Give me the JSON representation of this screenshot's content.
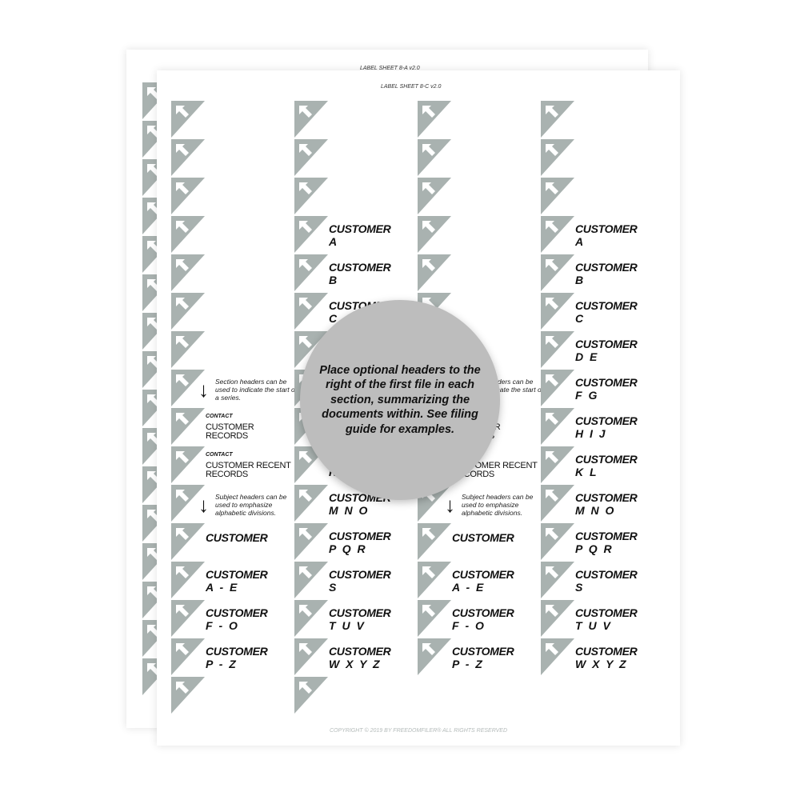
{
  "colors": {
    "tab": "#a9b2b0",
    "arrow": "#ffffff"
  },
  "back_sheet": {
    "header": "LABEL SHEET 8-A v2.0",
    "rows": 16
  },
  "front_sheet": {
    "header": "LABEL SHEET 8-C v2.0",
    "copyright": "COPYRIGHT © 2019 BY FREEDOMFILER® ALL RIGHTS RESERVED",
    "columns": [
      {
        "rows": 16,
        "labels": [
          {
            "row": 7,
            "type": "note",
            "text": "Section headers can be used to indicate the start of a series."
          },
          {
            "row": 8,
            "type": "contact",
            "kicker": "CONTACT",
            "text": "CUSTOMER RECORDS"
          },
          {
            "row": 9,
            "type": "contact",
            "kicker": "CONTACT",
            "text": "CUSTOMER RECENT RECORDS"
          },
          {
            "row": 10,
            "type": "note",
            "text": "Subject headers can be used to emphasize alphabetic divisions."
          },
          {
            "row": 11,
            "type": "cust",
            "text": "CUSTOMER",
            "sub": ""
          },
          {
            "row": 12,
            "type": "cust",
            "text": "CUSTOMER",
            "sub": "A - E"
          },
          {
            "row": 13,
            "type": "cust",
            "text": "CUSTOMER",
            "sub": "F - O"
          },
          {
            "row": 14,
            "type": "cust",
            "text": "CUSTOMER",
            "sub": "P - Z"
          }
        ]
      },
      {
        "rows": 16,
        "labels": [
          {
            "row": 3,
            "type": "cust",
            "text": "CUSTOMER",
            "sub": "A"
          },
          {
            "row": 4,
            "type": "cust",
            "text": "CUSTOMER",
            "sub": "B"
          },
          {
            "row": 5,
            "type": "cust",
            "text": "CUSTOMER",
            "sub": "C"
          },
          {
            "row": 9,
            "type": "cust",
            "text": "CUSTOMER",
            "sub": "K L"
          },
          {
            "row": 10,
            "type": "cust",
            "text": "CUSTOMER",
            "sub": "M N O"
          },
          {
            "row": 11,
            "type": "cust",
            "text": "CUSTOMER",
            "sub": "P Q R"
          },
          {
            "row": 12,
            "type": "cust",
            "text": "CUSTOMER",
            "sub": "S"
          },
          {
            "row": 13,
            "type": "cust",
            "text": "CUSTOMER",
            "sub": "T U V"
          },
          {
            "row": 14,
            "type": "cust",
            "text": "CUSTOMER",
            "sub": "W X Y Z"
          }
        ]
      },
      {
        "rows": 15,
        "labels": [
          {
            "row": 7,
            "type": "note",
            "text": "Section headers can be used to indicate the start of a series."
          },
          {
            "row": 8,
            "type": "contact",
            "kicker": "CONTACT",
            "text": "CUSTOMER RECORDS"
          },
          {
            "row": 9,
            "type": "contact",
            "kicker": "CONTACT",
            "text": "CUSTOMER RECENT RECORDS"
          },
          {
            "row": 10,
            "type": "note",
            "text": "Subject headers can be used to emphasize alphabetic divisions."
          },
          {
            "row": 11,
            "type": "cust",
            "text": "CUSTOMER",
            "sub": ""
          },
          {
            "row": 12,
            "type": "cust",
            "text": "CUSTOMER",
            "sub": "A - E"
          },
          {
            "row": 13,
            "type": "cust",
            "text": "CUSTOMER",
            "sub": "F - O"
          },
          {
            "row": 14,
            "type": "cust",
            "text": "CUSTOMER",
            "sub": "P - Z"
          }
        ]
      },
      {
        "rows": 15,
        "labels": [
          {
            "row": 3,
            "type": "cust",
            "text": "CUSTOMER",
            "sub": "A"
          },
          {
            "row": 4,
            "type": "cust",
            "text": "CUSTOMER",
            "sub": "B"
          },
          {
            "row": 5,
            "type": "cust",
            "text": "CUSTOMER",
            "sub": "C"
          },
          {
            "row": 6,
            "type": "cust",
            "text": "CUSTOMER",
            "sub": "D E"
          },
          {
            "row": 7,
            "type": "cust",
            "text": "CUSTOMER",
            "sub": "F G"
          },
          {
            "row": 8,
            "type": "cust",
            "text": "CUSTOMER",
            "sub": "H I J"
          },
          {
            "row": 9,
            "type": "cust",
            "text": "CUSTOMER",
            "sub": "K L"
          },
          {
            "row": 10,
            "type": "cust",
            "text": "CUSTOMER",
            "sub": "M N O"
          },
          {
            "row": 11,
            "type": "cust",
            "text": "CUSTOMER",
            "sub": "P Q R"
          },
          {
            "row": 12,
            "type": "cust",
            "text": "CUSTOMER",
            "sub": "S"
          },
          {
            "row": 13,
            "type": "cust",
            "text": "CUSTOMER",
            "sub": "T U V"
          },
          {
            "row": 14,
            "type": "cust",
            "text": "CUSTOMER",
            "sub": "W X Y Z"
          }
        ]
      }
    ]
  },
  "callout": {
    "text": "Place optional headers to the right of the first file in each section, summarizing the documents within. See filing guide for examples."
  }
}
